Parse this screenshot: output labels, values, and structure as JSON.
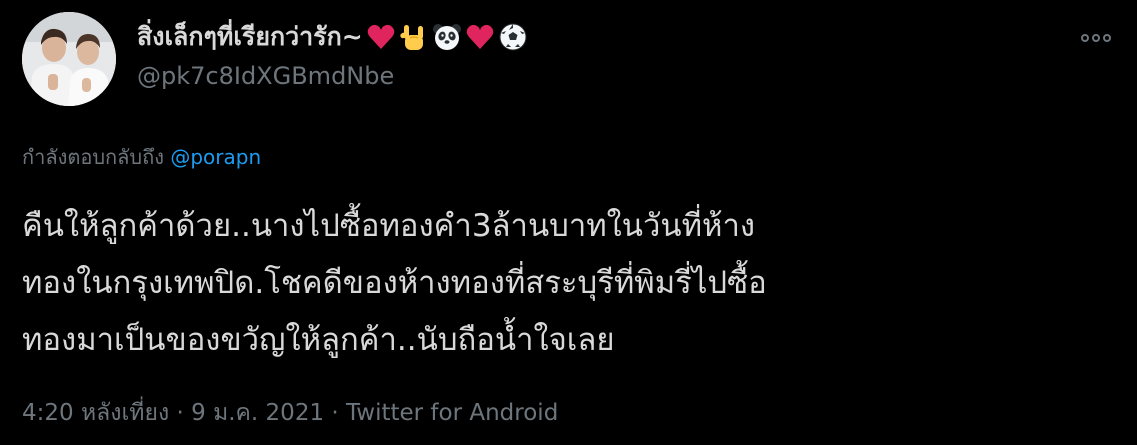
{
  "tweet": {
    "author": {
      "display_name": "สิ่งเล็กๆที่เรียกว่ารัก~",
      "name_emojis": [
        "red-heart-icon",
        "love-you-gesture-icon",
        "panda-face-icon",
        "red-heart-icon",
        "soccer-ball-icon"
      ],
      "handle": "@pk7c8IdXGBmdNbe",
      "avatar": "profile-photo"
    },
    "more_icon": "more-horizontal-icon",
    "reply_context": {
      "prefix": "กำลังตอบกลับถึง",
      "mention": "@porapn"
    },
    "text": "คืนให้ลูกค้าด้วย..นางไปซื้อทองคำ3ล้านบาทในวันที่ห้าง\nทองในกรุงเทพปิด.โชคดีของห้างทองที่สระบุรีที่พิมรี่ไปซื้อ\nทองมาเป็นของขวัญให้ลูกค้า..นับถือน้ำใจเลย",
    "meta": {
      "time": "4:20 หลังเที่ยง",
      "separator_1": "·",
      "date": "9 ม.ค. 2021",
      "separator_2": "·",
      "source": "Twitter for Android"
    }
  },
  "colors": {
    "background": "#000000",
    "primary_text": "#d9d9d9",
    "secondary_text": "#6e767d",
    "link": "#1d9bf0",
    "heart": "#e0245e"
  }
}
